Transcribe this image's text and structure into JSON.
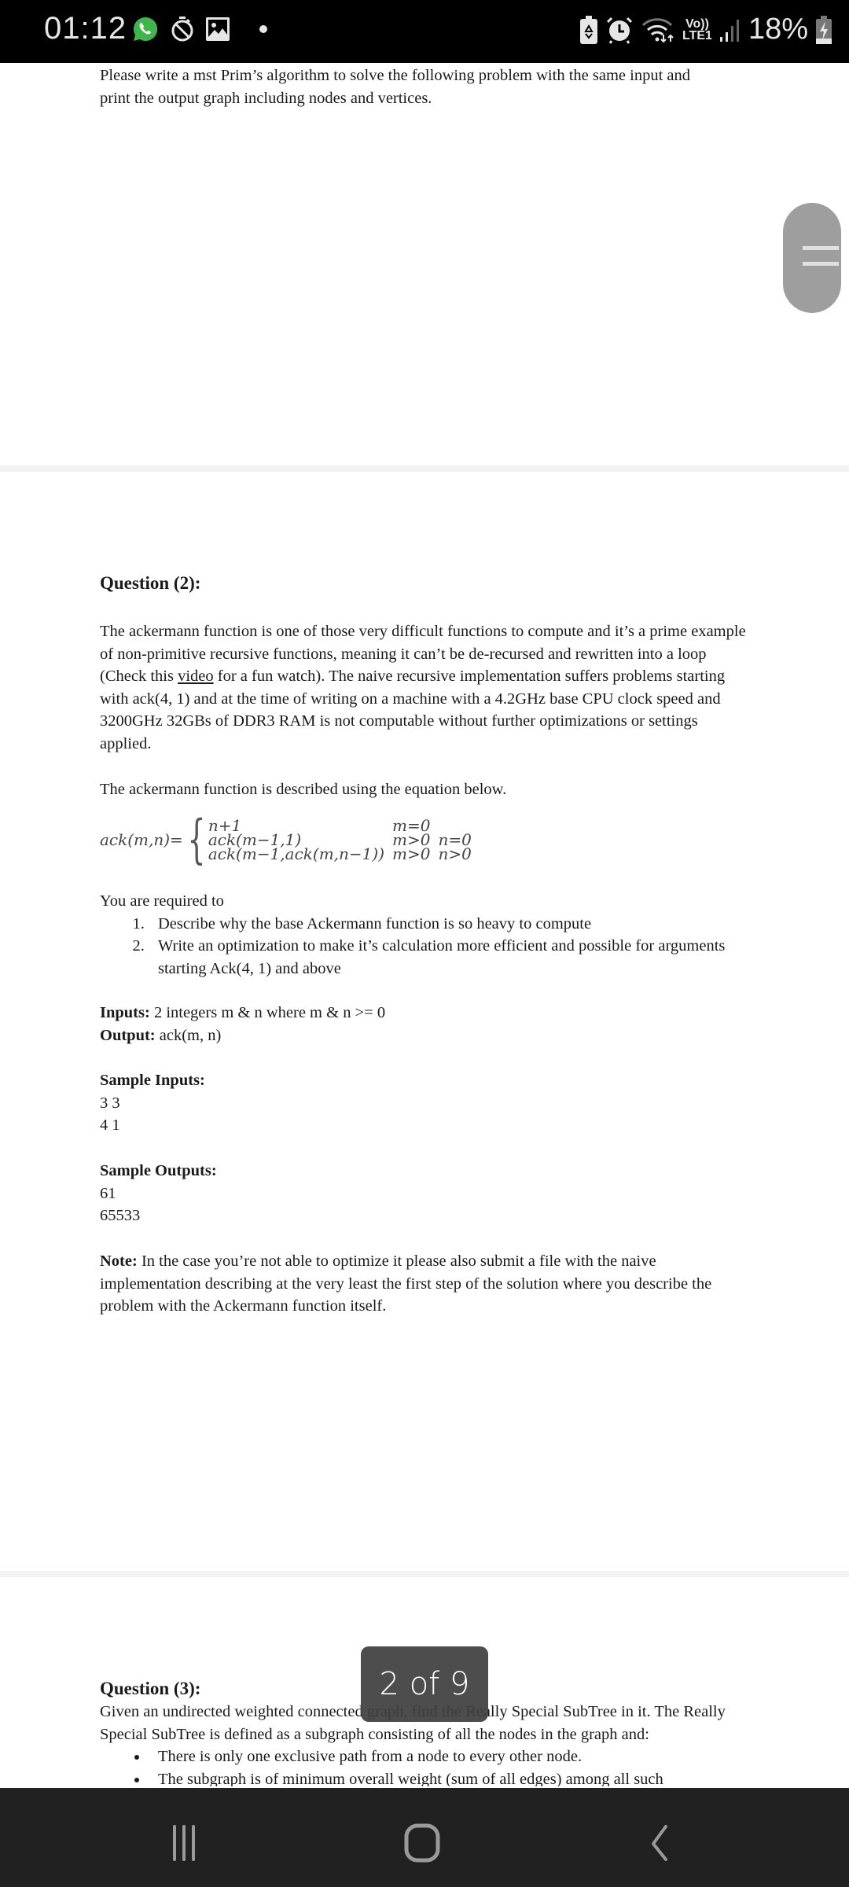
{
  "status_bar": {
    "time": "01:12",
    "left_icons": [
      "whatsapp-icon",
      "timer-off-icon",
      "gallery-icon",
      "notification-dot"
    ],
    "right_icons": [
      "battery-saver-icon",
      "alarm-icon",
      "wifi-icon",
      "volte-lte-icon",
      "signal-icon",
      "battery-charging-icon"
    ],
    "volte_line1": "Vo))",
    "volte_line2": "LTE1",
    "battery_percent": "18%"
  },
  "document": {
    "page1_tail": {
      "line1": "Please write a mst Prim’s algorithm to solve the following problem with the same input and",
      "line2": "print the output graph including nodes and vertices."
    },
    "question2": {
      "heading": "Question (2):",
      "para1_a": "The ackermann function is one of those very difficult functions to compute and it’s a prime example of non-primitive recursive functions, meaning it can’t be de-recursed and rewritten into a loop (Check this ",
      "para1_link": "video",
      "para1_b": " for a fun watch). The naive recursive implementation suffers problems starting with ack(4, 1) and at the time of writing on a machine with a 4.2GHz base CPU clock speed and 3200GHz 32GBs of DDR3 RAM is not computable without further optimizations or settings applied.",
      "para2": "The ackermann function is described using the equation below.",
      "equation": {
        "lhs": "ack(m,n)=",
        "cases": [
          {
            "expr": "n+1",
            "cond1": "m=0",
            "cond2": ""
          },
          {
            "expr": "ack(m−1,1)",
            "cond1": "m>0",
            "cond2": "n=0"
          },
          {
            "expr": "ack(m−1,ack(m,n−1))",
            "cond1": "m>0",
            "cond2": "n>0"
          }
        ]
      },
      "required_intro": "You are required to",
      "requirements": [
        "Describe why the base Ackermann function is so heavy to compute",
        "Write an optimization to make it’s calculation more efficient and possible for arguments starting Ack(4, 1) and above"
      ],
      "inputs_label": "Inputs:",
      "inputs_text": " 2 integers m & n where m & n >= 0",
      "output_label": "Output:",
      "output_text": " ack(m, n)",
      "sample_inputs_label": "Sample Inputs:",
      "sample_inputs": [
        "3 3",
        "4 1"
      ],
      "sample_outputs_label": "Sample Outputs:",
      "sample_outputs": [
        "61",
        "65533"
      ],
      "note_label": "Note:",
      "note_text": " In the case you’re not able to optimize it please also submit a file with the naive implementation describing at the very least the first step of the solution where you describe the problem with the Ackermann function itself."
    },
    "question3": {
      "heading": "Question (3):",
      "para1": "Given an undirected weighted connected graph, find the Really Special SubTree in it. The Really Special SubTree is defined as a subgraph consisting of all the nodes in the graph and:",
      "bullets": [
        "There is only one exclusive path from a node to every other node.",
        "The subgraph is of minimum overall weight (sum of all edges) among all such"
      ]
    }
  },
  "page_indicator": {
    "current": 2,
    "total": 9,
    "label": "2 of 9"
  },
  "nav_bar": {
    "buttons": [
      "recent-apps",
      "home",
      "back"
    ]
  }
}
